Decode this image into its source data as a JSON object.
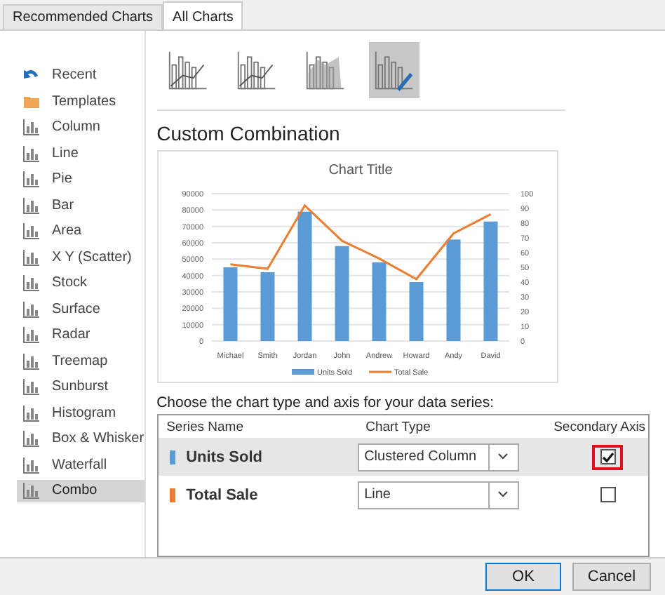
{
  "tabs": [
    {
      "label": "Recommended Charts",
      "selected": false
    },
    {
      "label": "All Charts",
      "selected": true
    }
  ],
  "sidebar": {
    "items": [
      {
        "label": "Recent",
        "selected": false
      },
      {
        "label": "Templates",
        "selected": false
      },
      {
        "label": "Column",
        "selected": false
      },
      {
        "label": "Line",
        "selected": false
      },
      {
        "label": "Pie",
        "selected": false
      },
      {
        "label": "Bar",
        "selected": false
      },
      {
        "label": "Area",
        "selected": false
      },
      {
        "label": "X Y (Scatter)",
        "selected": false
      },
      {
        "label": "Stock",
        "selected": false
      },
      {
        "label": "Surface",
        "selected": false
      },
      {
        "label": "Radar",
        "selected": false
      },
      {
        "label": "Treemap",
        "selected": false
      },
      {
        "label": "Sunburst",
        "selected": false
      },
      {
        "label": "Histogram",
        "selected": false
      },
      {
        "label": "Box & Whisker",
        "selected": false
      },
      {
        "label": "Waterfall",
        "selected": false
      },
      {
        "label": "Combo",
        "selected": true
      }
    ]
  },
  "subtypes": [
    {
      "selected": false
    },
    {
      "selected": false
    },
    {
      "selected": false
    },
    {
      "selected": true
    }
  ],
  "heading": "Custom Combination",
  "preview": {
    "chart_data": {
      "type": "bar",
      "title": "Chart Title",
      "categories": [
        "Michael",
        "Smith",
        "Jordan",
        "John",
        "Andrew",
        "Howard",
        "Andy",
        "David"
      ],
      "series": [
        {
          "name": "Units Sold",
          "color": "#5b9bd5",
          "values": [
            45000,
            42000,
            79000,
            58000,
            48000,
            36000,
            62000,
            73000
          ]
        },
        {
          "name": "Total Sale",
          "color": "#ed7d31",
          "type": "line",
          "axis": "y2",
          "values": [
            52,
            49,
            92,
            68,
            56,
            42,
            73,
            86
          ]
        }
      ],
      "grid": true,
      "legend": "bottom",
      "ylim": [
        0,
        90000
      ],
      "yticks": [
        0,
        10000,
        20000,
        30000,
        40000,
        50000,
        60000,
        70000,
        80000,
        90000
      ],
      "y2lim": [
        0,
        100
      ],
      "y2ticks": [
        0,
        10,
        20,
        30,
        40,
        50,
        60,
        70,
        80,
        90,
        100
      ]
    }
  },
  "series_table": {
    "prompt": "Choose the chart type and axis for your data series:",
    "columns": [
      "Series Name",
      "Chart Type",
      "Secondary Axis"
    ],
    "rows": [
      {
        "name": "Units Sold",
        "color": "#5b9bd5",
        "chart_type": "Clustered Column",
        "secondary_axis": true,
        "selected": true,
        "highlighted": true
      },
      {
        "name": "Total Sale",
        "color": "#ed7d31",
        "chart_type": "Line",
        "secondary_axis": false,
        "selected": false,
        "highlighted": false
      }
    ]
  },
  "buttons": [
    "OK",
    "Cancel"
  ]
}
